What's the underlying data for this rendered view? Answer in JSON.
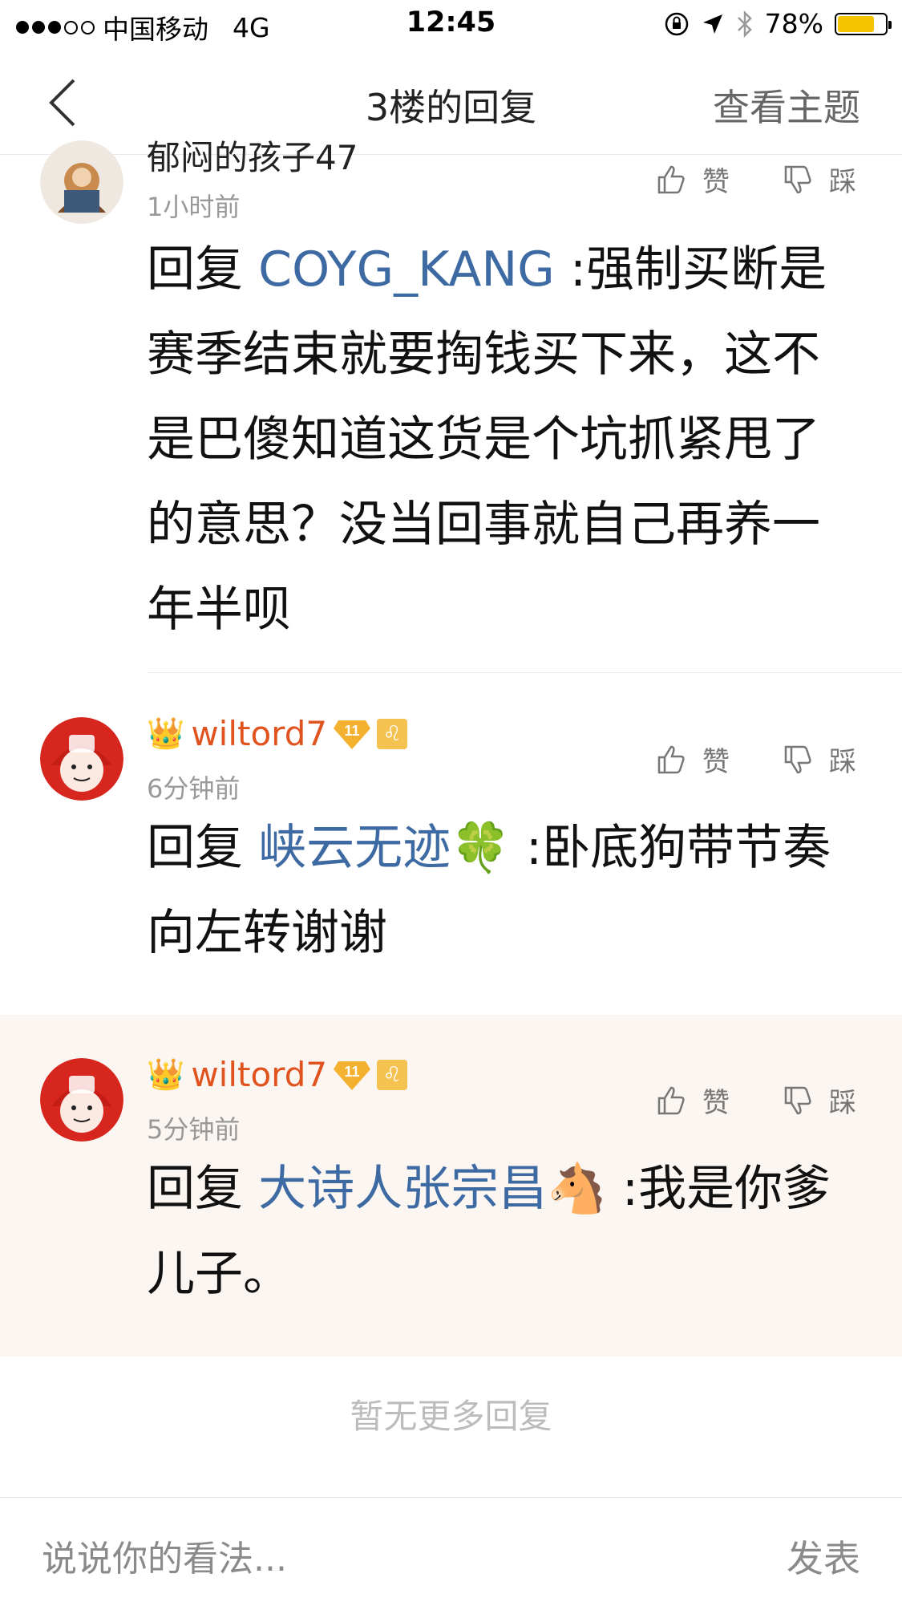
{
  "status_bar": {
    "carrier": "中国移动",
    "network": "4G",
    "time": "12:45",
    "battery": "78%",
    "battery_fill": 0.78
  },
  "nav": {
    "title": "3楼的回复",
    "right_label": "查看主题"
  },
  "comments": [
    {
      "username": "郁闷的孩子47",
      "time": "1小时前",
      "reply_prefix": "回复 ",
      "mention": "COYG_KANG",
      "mention_emoji": "",
      "text": " :强制买断是赛季结束就要掏钱买下来，这不是巴傻知道这货是个坑抓紧甩了的意思？没当回事就自己再养一年半呗",
      "like_label": "赞",
      "dislike_label": "踩"
    },
    {
      "username": "wiltord7",
      "level": "11",
      "time": "6分钟前",
      "reply_prefix": "回复 ",
      "mention": "峡云无迹",
      "mention_emoji": "🍀",
      "text": " :卧底狗带节奏向左转谢谢",
      "like_label": "赞",
      "dislike_label": "踩"
    },
    {
      "username": "wiltord7",
      "level": "11",
      "time": "5分钟前",
      "reply_prefix": "回复 ",
      "mention": "大诗人张宗昌",
      "mention_emoji": "🐴",
      "text": " :我是你爹儿子。",
      "like_label": "赞",
      "dislike_label": "踩"
    }
  ],
  "no_more": "暂无更多回复",
  "input": {
    "placeholder": "说说你的看法...",
    "post_label": "发表"
  },
  "colors": {
    "username": "#e0531f",
    "mention": "#3e6aa3",
    "highlight_bg": "#fbf6f1"
  }
}
